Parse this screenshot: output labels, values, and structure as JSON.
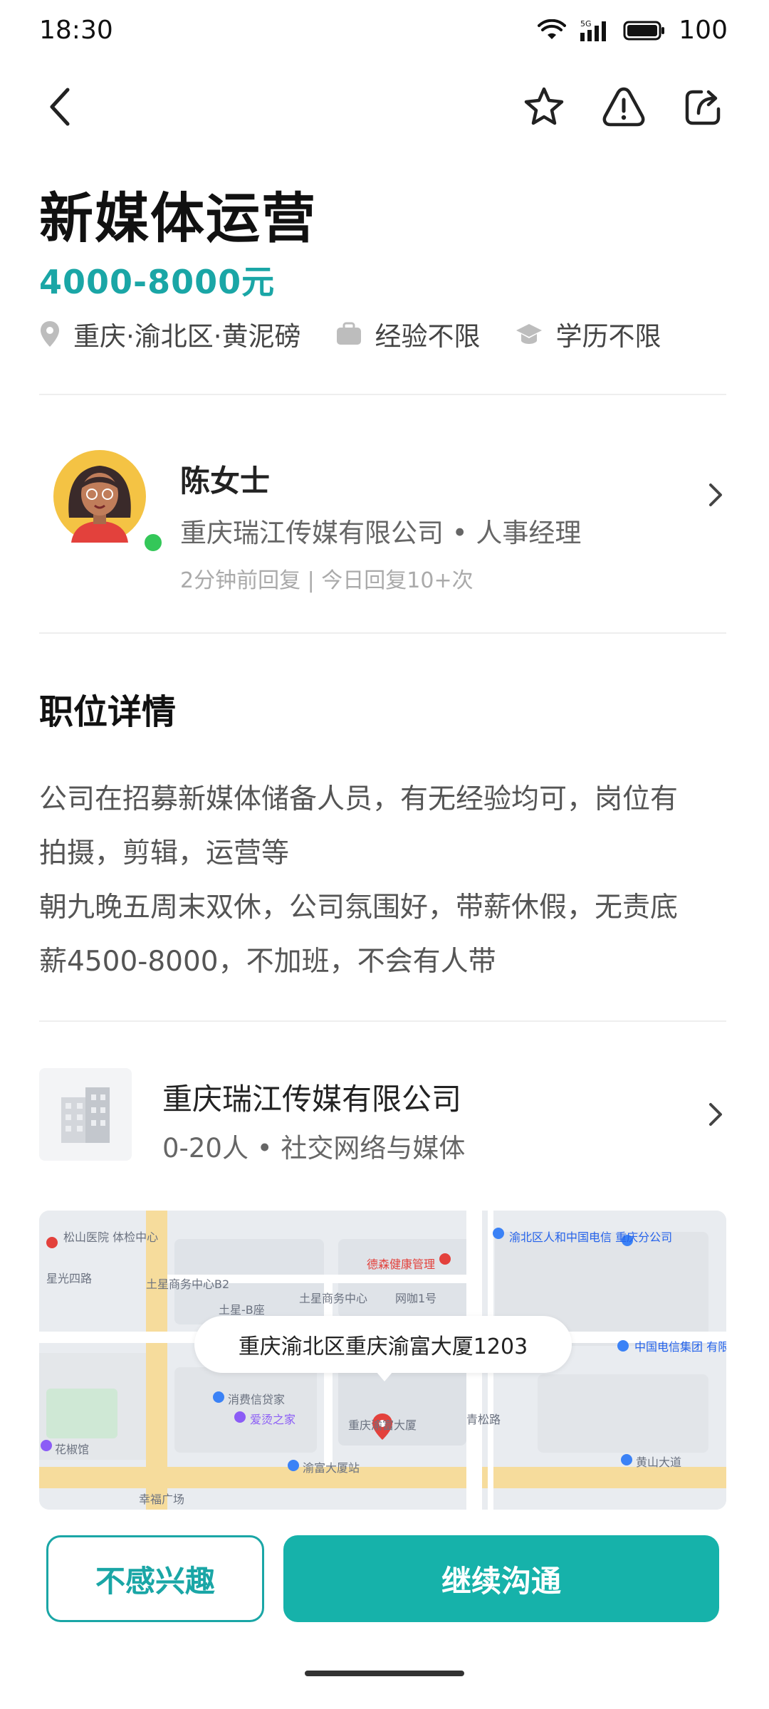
{
  "status_bar": {
    "time": "18:30",
    "battery": "100"
  },
  "job": {
    "title": "新媒体运营",
    "salary": "4000-8000元",
    "tags": {
      "location": "重庆·渝北区·黄泥磅",
      "experience": "经验不限",
      "education": "学历不限"
    }
  },
  "recruiter": {
    "name": "陈女士",
    "company_role": "重庆瑞江传媒有限公司 • 人事经理",
    "reply_info": "2分钟前回复 | 今日回复10+次"
  },
  "details": {
    "section_title": "职位详情",
    "lines": [
      "公司在招募新媒体储备人员，有无经验均可，岗位有",
      "拍摄，剪辑，运营等",
      "朝九晚五周末双休，公司氛围好，带薪休假，无责底",
      "薪4500-8000，不加班，不会有人带"
    ]
  },
  "company": {
    "name": "重庆瑞江传媒有限公司",
    "meta": "0-20人 • 社交网络与媒体"
  },
  "map": {
    "address": "重庆渝北区重庆渝富大厦1203",
    "labels": {
      "l1": "松山医院 体检中心",
      "l2": "星光四路",
      "l3": "土星商务中心B2",
      "l4": "土星-B座",
      "l5": "土星商务中心",
      "l6": "德森健康管理",
      "l7": "网咖1号",
      "l8": "渝北区人和中国电信 重庆分公司",
      "l9": "中国电信集团 有限公司",
      "l10": "消费信贷家",
      "l11": "爱烫之家",
      "l12": "重庆渝富大厦",
      "l13": "渝富大厦站",
      "l14": "黄山大道",
      "l15": "幸福广场",
      "l16": "青松路",
      "l17": "花椒馆"
    }
  },
  "actions": {
    "not_interested": "不感兴趣",
    "continue_chat": "继续沟通"
  },
  "colors": {
    "accent": "#1aa6a6",
    "primary_button": "#16b2aa",
    "online": "#34c759"
  }
}
